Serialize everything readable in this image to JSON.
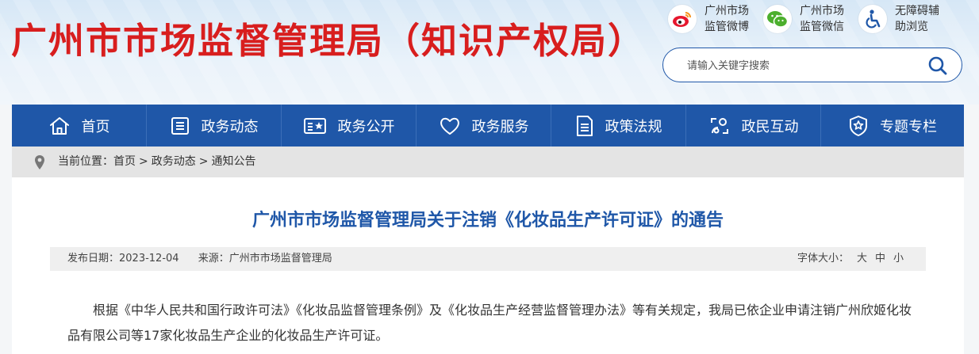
{
  "header": {
    "title": "广州市市场监督管理局（知识产权局）",
    "quick_links": [
      {
        "icon": "weibo-icon",
        "label": "广州市场监管微博"
      },
      {
        "icon": "wechat-icon",
        "label": "广州市场监管微信"
      },
      {
        "icon": "accessibility-icon",
        "label": "无障碍辅助浏览"
      }
    ],
    "search": {
      "placeholder": "请输入关键字搜索"
    }
  },
  "nav": {
    "items": [
      {
        "icon": "home-icon",
        "label": "首页"
      },
      {
        "icon": "list-icon",
        "label": "政务动态"
      },
      {
        "icon": "star-board-icon",
        "label": "政务公开"
      },
      {
        "icon": "heart-icon",
        "label": "政务服务"
      },
      {
        "icon": "document-icon",
        "label": "政策法规"
      },
      {
        "icon": "interaction-icon",
        "label": "政民互动"
      },
      {
        "icon": "shield-star-icon",
        "label": "专题专栏"
      }
    ]
  },
  "breadcrumb": {
    "prefix": "当前位置：",
    "items": [
      "首页",
      "政务动态",
      "通知公告"
    ],
    "separator": ">"
  },
  "article": {
    "title": "广州市市场监督管理局关于注销《化妆品生产许可证》的通告",
    "date_label": "发布日期：",
    "date": "2023-12-04",
    "source_label": "来源：",
    "source": "广州市市场监督管理局",
    "font_size_label": "字体大小：",
    "font_sizes": [
      "大",
      "中",
      "小"
    ],
    "paragraph": "根据《中华人民共和国行政许可法》《化妆品监督管理条例》及《化妆品生产经营监督管理办法》等有关规定，我局已依企业申请注销广州欣姬化妆品有限公司等17家化妆品生产企业的化妆品生产许可证。"
  },
  "colors": {
    "title_red": "#d81e1e",
    "nav_blue": "#1f57a8",
    "weibo_red": "#e6162d",
    "wechat_green": "#4caf2e",
    "accessibility_blue": "#1f57a8"
  }
}
